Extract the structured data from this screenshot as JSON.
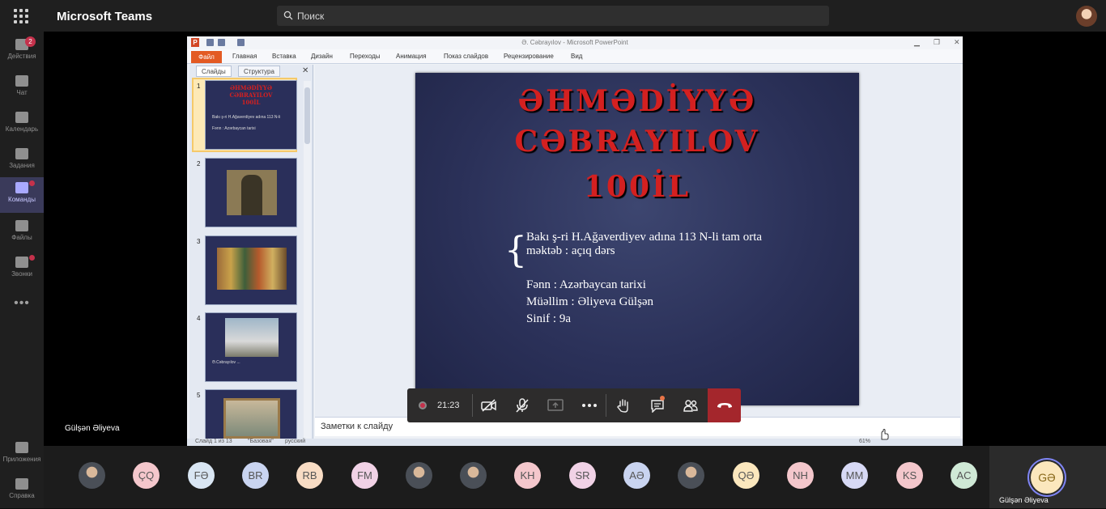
{
  "app": {
    "title": "Microsoft Teams",
    "search_placeholder": "Поиск"
  },
  "rail": {
    "items": [
      {
        "label": "Действия",
        "badge": "2"
      },
      {
        "label": "Чат"
      },
      {
        "label": "Календарь"
      },
      {
        "label": "Задания"
      },
      {
        "label": "Команды"
      },
      {
        "label": "Файлы"
      },
      {
        "label": "Звонки"
      }
    ],
    "more": "•••",
    "apps": "Приложения",
    "help": "Справка"
  },
  "presenter": {
    "name": "Gülşən Əliyeva"
  },
  "powerpoint": {
    "window_title": "Ə. Cəbrayılov - Microsoft PowerPoint",
    "logo": "P",
    "tabs": [
      "Файл",
      "Главная",
      "Вставка",
      "Дизайн",
      "Переходы",
      "Анимация",
      "Показ слайдов",
      "Рецензирование",
      "Вид"
    ],
    "pane_tabs": [
      "Слайды",
      "Структура"
    ],
    "pane_close": "✕",
    "thumb_numbers": [
      "1",
      "2",
      "3",
      "4",
      "5"
    ],
    "notes_placeholder": "Заметки к слайду",
    "status_left": "Слайд 1 из 13",
    "status_theme": "\"Базовая\"",
    "status_lang": "русский",
    "zoom": "61%"
  },
  "slide": {
    "title_lines": [
      "ƏHMƏDİYYƏ",
      "CƏBRAYILOV",
      "100İL"
    ],
    "brace": "{",
    "lines": [
      "Bakı ş-ri H.Ağaverdiyev adına 113 N-li tam orta",
      "məktəb : açıq dərs",
      "Fənn : Azərbaycan tarixi",
      "Müəllim : Əliyeva Gülşən",
      "Sinif : 9a"
    ]
  },
  "call": {
    "timer": "21:23"
  },
  "participants": [
    "",
    "ÇQ",
    "FƏ",
    "BR",
    "RB",
    "FM",
    "",
    "",
    "KH",
    "SR",
    "AƏ",
    "",
    "QƏ",
    "NH",
    "MM",
    "KS",
    "AC"
  ],
  "participant_colors": [
    "#777",
    "#f4c7cc",
    "#d9e6f3",
    "#c9d4f0",
    "#f8dcc4",
    "#f1d2e6",
    "#777",
    "#777",
    "#f4c7cc",
    "#f1d2e6",
    "#c9d4f0",
    "#777",
    "#fbe7bd",
    "#f4c7cc",
    "#d7d9f5",
    "#f4c7cc",
    "#cfe9d6"
  ],
  "self": {
    "initials": "GƏ",
    "name": "Gülşən Əliyeva"
  }
}
